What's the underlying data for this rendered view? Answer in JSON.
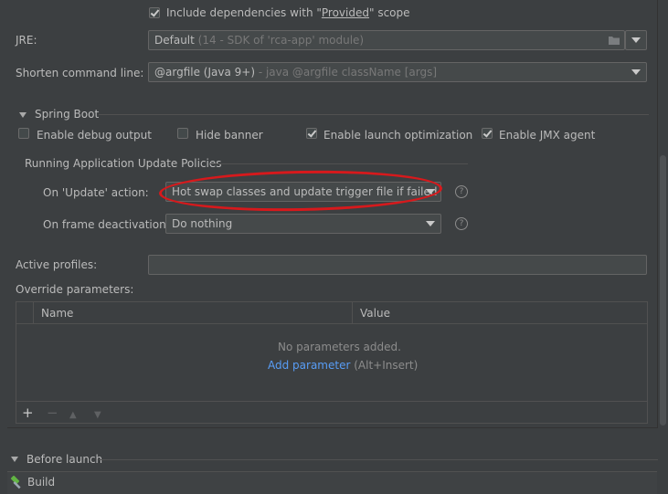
{
  "include_deps": {
    "label_pre": "Include dependencies with \"",
    "label_mid": "Provided",
    "label_post": "\" scope",
    "checked": true
  },
  "jre": {
    "label": "JRE:",
    "value_main": "Default",
    "value_dim": " (14 - SDK of 'rca-app' module)"
  },
  "shorten": {
    "label": "Shorten command line:",
    "value_main": "@argfile (Java 9+)",
    "value_dim": " - java @argfile className [args]"
  },
  "spring_boot": {
    "title": "Spring Boot",
    "checkboxes": [
      {
        "label": "Enable debug output",
        "checked": false
      },
      {
        "label": "Hide banner",
        "checked": false
      },
      {
        "label": "Enable launch optimization",
        "checked": true
      },
      {
        "label": "Enable JMX agent",
        "checked": true
      }
    ]
  },
  "policies": {
    "title": "Running Application Update Policies",
    "update_label": "On 'Update' action:",
    "update_value": "Hot swap classes and update trigger file if failed",
    "frame_label": "On frame deactivation:",
    "frame_value": "Do nothing",
    "help_glyph": "?"
  },
  "active_profiles": {
    "label": "Active profiles:",
    "value": ""
  },
  "override": {
    "label": "Override parameters:",
    "columns": [
      "Name",
      "Value"
    ],
    "empty_text": "No parameters added.",
    "add_link": "Add parameter",
    "add_shortcut": " (Alt+Insert)",
    "toolbar": {
      "add": "+",
      "remove": "−",
      "up": "▲",
      "down": "▼"
    }
  },
  "before_launch": {
    "title": "Before launch"
  },
  "build": {
    "label": "Build",
    "icon": "hammer-icon"
  },
  "colors": {
    "annotation": "#d7191c",
    "link": "#589df6",
    "background": "#3c3f41"
  }
}
